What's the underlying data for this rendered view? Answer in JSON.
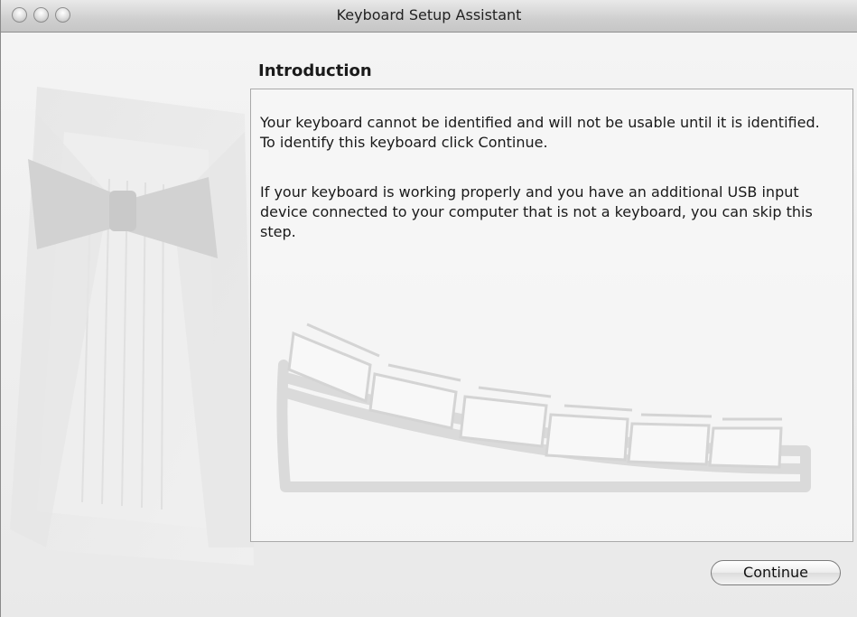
{
  "window": {
    "title": "Keyboard Setup Assistant"
  },
  "main": {
    "heading": "Introduction",
    "paragraphs": [
      "Your keyboard cannot be identified and will not be usable until it is identified. To identify this keyboard click Continue.",
      "If your keyboard is working properly and you have an additional USB input device connected to your computer that is not a keyboard, you can skip this step."
    ]
  },
  "buttons": {
    "continue": "Continue"
  },
  "icons": {
    "close": "close-button-icon",
    "minimize": "minimize-button-icon",
    "zoom": "zoom-button-icon",
    "illustration": "keyboard-illustration-icon",
    "background": "tuxedo-background-image"
  }
}
